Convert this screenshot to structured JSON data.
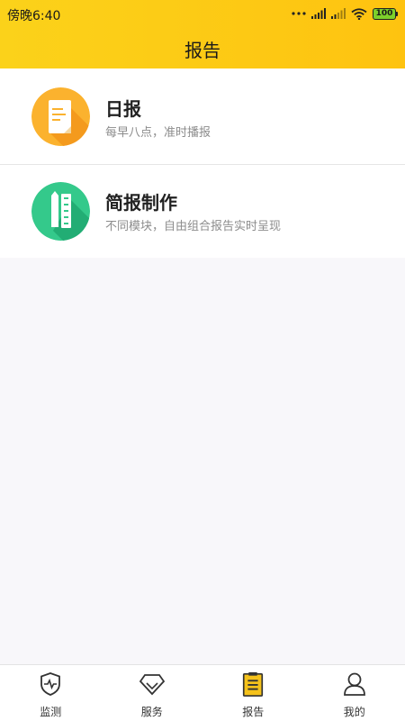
{
  "status_bar": {
    "time": "傍晚6:40",
    "battery_level": "100",
    "icons": [
      "dots-icon",
      "signal-icon",
      "signal-weak-icon",
      "wifi-icon",
      "battery-icon"
    ]
  },
  "header": {
    "title": "报告"
  },
  "list": [
    {
      "title": "日报",
      "subtitle": "每早八点，准时播报",
      "icon": "document-icon",
      "color": "#fbb22e"
    },
    {
      "title": "简报制作",
      "subtitle": "不同模块，自由组合报告实时呈现",
      "icon": "pencil-ruler-icon",
      "color": "#34c98b"
    }
  ],
  "tabbar": {
    "tabs": [
      {
        "label": "监测",
        "icon": "shield-pulse-icon"
      },
      {
        "label": "服务",
        "icon": "diamond-icon"
      },
      {
        "label": "报告",
        "icon": "clipboard-icon",
        "active": true
      },
      {
        "label": "我的",
        "icon": "user-icon"
      }
    ]
  },
  "colors": {
    "accent": "#fec310",
    "header_start": "#fbd21a",
    "active_tab_fill": "#f5c21b"
  }
}
